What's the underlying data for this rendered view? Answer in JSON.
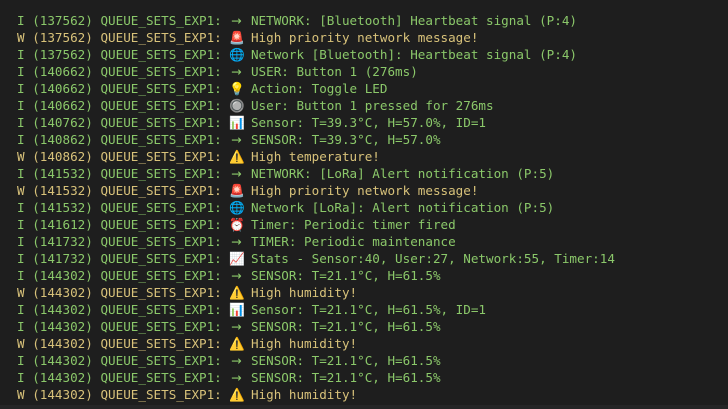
{
  "log": {
    "lines": [
      {
        "level": "I",
        "pid": "(137562)",
        "tag": "QUEUE_SETS_EXP1:",
        "icon": "→",
        "icon_name": "arrow-right-icon",
        "text": "NETWORK: [Bluetooth] Heartbeat signal (P:4)"
      },
      {
        "level": "W",
        "pid": "(137562)",
        "tag": "QUEUE_SETS_EXP1:",
        "icon": "🚨",
        "icon_name": "siren-icon",
        "text": "High priority network message!"
      },
      {
        "level": "I",
        "pid": "(137562)",
        "tag": "QUEUE_SETS_EXP1:",
        "icon": "🌐",
        "icon_name": "globe-icon",
        "text": "Network [Bluetooth]: Heartbeat signal (P:4)"
      },
      {
        "level": "I",
        "pid": "(140662)",
        "tag": "QUEUE_SETS_EXP1:",
        "icon": "→",
        "icon_name": "arrow-right-icon",
        "text": "USER: Button 1 (276ms)"
      },
      {
        "level": "I",
        "pid": "(140662)",
        "tag": "QUEUE_SETS_EXP1:",
        "icon": "💡",
        "icon_name": "lightbulb-icon",
        "text": "Action: Toggle LED"
      },
      {
        "level": "I",
        "pid": "(140662)",
        "tag": "QUEUE_SETS_EXP1:",
        "icon": "🔘",
        "icon_name": "radio-button-icon",
        "text": "User: Button 1 pressed for 276ms"
      },
      {
        "level": "I",
        "pid": "(140762)",
        "tag": "QUEUE_SETS_EXP1:",
        "icon": "📊",
        "icon_name": "bar-chart-icon",
        "text": "Sensor: T=39.3°C, H=57.0%, ID=1"
      },
      {
        "level": "I",
        "pid": "(140862)",
        "tag": "QUEUE_SETS_EXP1:",
        "icon": "→",
        "icon_name": "arrow-right-icon",
        "text": "SENSOR: T=39.3°C, H=57.0%"
      },
      {
        "level": "W",
        "pid": "(140862)",
        "tag": "QUEUE_SETS_EXP1:",
        "icon": "⚠️",
        "icon_name": "warning-icon",
        "text": "High temperature!"
      },
      {
        "level": "I",
        "pid": "(141532)",
        "tag": "QUEUE_SETS_EXP1:",
        "icon": "→",
        "icon_name": "arrow-right-icon",
        "text": "NETWORK: [LoRa] Alert notification (P:5)"
      },
      {
        "level": "W",
        "pid": "(141532)",
        "tag": "QUEUE_SETS_EXP1:",
        "icon": "🚨",
        "icon_name": "siren-icon",
        "text": "High priority network message!"
      },
      {
        "level": "I",
        "pid": "(141532)",
        "tag": "QUEUE_SETS_EXP1:",
        "icon": "🌐",
        "icon_name": "globe-icon",
        "text": "Network [LoRa]: Alert notification (P:5)"
      },
      {
        "level": "I",
        "pid": "(141612)",
        "tag": "QUEUE_SETS_EXP1:",
        "icon": "⏰",
        "icon_name": "alarm-clock-icon",
        "text": "Timer: Periodic timer fired"
      },
      {
        "level": "I",
        "pid": "(141732)",
        "tag": "QUEUE_SETS_EXP1:",
        "icon": "→",
        "icon_name": "arrow-right-icon",
        "text": "TIMER: Periodic maintenance"
      },
      {
        "level": "I",
        "pid": "(141732)",
        "tag": "QUEUE_SETS_EXP1:",
        "icon": "📈",
        "icon_name": "trend-chart-icon",
        "text": "Stats - Sensor:40, User:27, Network:55, Timer:14"
      },
      {
        "level": "I",
        "pid": "(144302)",
        "tag": "QUEUE_SETS_EXP1:",
        "icon": "→",
        "icon_name": "arrow-right-icon",
        "text": "SENSOR: T=21.1°C, H=61.5%"
      },
      {
        "level": "W",
        "pid": "(144302)",
        "tag": "QUEUE_SETS_EXP1:",
        "icon": "⚠️",
        "icon_name": "warning-icon",
        "text": "High humidity!"
      },
      {
        "level": "I",
        "pid": "(144302)",
        "tag": "QUEUE_SETS_EXP1:",
        "icon": "📊",
        "icon_name": "bar-chart-icon",
        "text": "Sensor: T=21.1°C, H=61.5%, ID=1"
      },
      {
        "level": "I",
        "pid": "(144302)",
        "tag": "QUEUE_SETS_EXP1:",
        "icon": "→",
        "icon_name": "arrow-right-icon",
        "text": "SENSOR: T=21.1°C, H=61.5%"
      },
      {
        "level": "W",
        "pid": "(144302)",
        "tag": "QUEUE_SETS_EXP1:",
        "icon": "⚠️",
        "icon_name": "warning-icon",
        "text": "High humidity!"
      },
      {
        "level": "I",
        "pid": "(144302)",
        "tag": "QUEUE_SETS_EXP1:",
        "icon": "→",
        "icon_name": "arrow-right-icon",
        "text": "SENSOR: T=21.1°C, H=61.5%"
      },
      {
        "level": "I",
        "pid": "(144302)",
        "tag": "QUEUE_SETS_EXP1:",
        "icon": "→",
        "icon_name": "arrow-right-icon",
        "text": "SENSOR: T=21.1°C, H=61.5%"
      },
      {
        "level": "W",
        "pid": "(144302)",
        "tag": "QUEUE_SETS_EXP1:",
        "icon": "⚠️",
        "icon_name": "warning-icon",
        "text": "High humidity!"
      }
    ]
  },
  "colors": {
    "background": "#1e1e1e",
    "info": "#8bc86a",
    "warning": "#d8c27a"
  }
}
